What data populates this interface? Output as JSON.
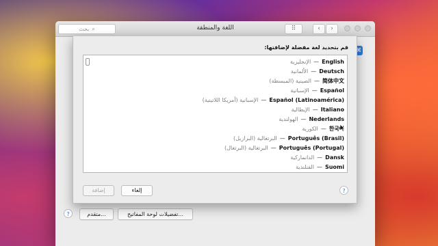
{
  "window": {
    "title": "اللغة والمنطقة",
    "search_placeholder": "بحث",
    "grid_icon": "⠿",
    "back_icon": "‹",
    "forward_icon": "›"
  },
  "bottom": {
    "keyboard_prefs_label": "تفضيلات لوحة المفاتيح...",
    "advanced_label": "متقدم...",
    "help_label": "?"
  },
  "sheet": {
    "prompt": "قم بتحديد لغة مفضلة لإضافتها:",
    "cancel_label": "إلغاء",
    "add_label": "إضافة",
    "help_label": "?",
    "languages": [
      {
        "native": "English",
        "arabic": "الإنجليزية"
      },
      {
        "native": "Deutsch",
        "arabic": "الألمانية"
      },
      {
        "native": "简体中文",
        "arabic": "الصينية (المبسطة)"
      },
      {
        "native": "Español",
        "arabic": "الإسبانية"
      },
      {
        "native": "Español (Latinoamérica)",
        "arabic": "الإسبانية (أمريكا اللاتينية)"
      },
      {
        "native": "Italiano",
        "arabic": "الإيطالية"
      },
      {
        "native": "Nederlands",
        "arabic": "الهولندية"
      },
      {
        "native": "한국어",
        "arabic": "الكورية"
      },
      {
        "native": "Português (Brasil)",
        "arabic": "البرتغالية (البرازيل)"
      },
      {
        "native": "Português (Portugal)",
        "arabic": "البرتغالية (البرتغال)"
      },
      {
        "native": "Dansk",
        "arabic": "الدانماركية"
      },
      {
        "native": "Suomi",
        "arabic": "الفنلندية"
      }
    ]
  },
  "colors": {
    "accent": "#2a7ae2",
    "window_bg": "#ececec",
    "list_bg": "#ffffff"
  }
}
